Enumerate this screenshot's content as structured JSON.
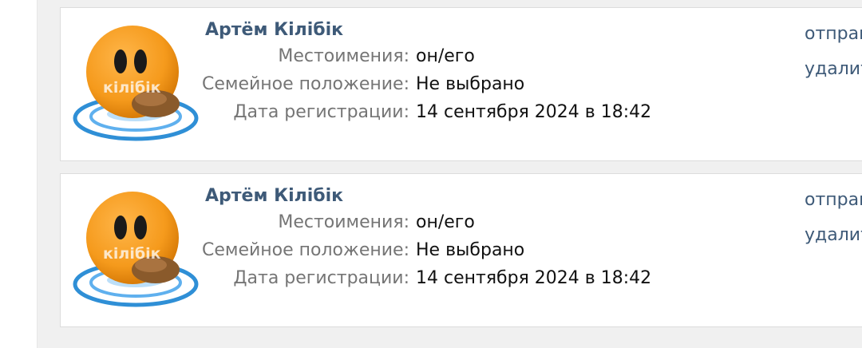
{
  "users": [
    {
      "name": "Артём Кілібік",
      "avatar_text": "кілібік",
      "fields": [
        {
          "label": "Местоимения:",
          "value": "он/его"
        },
        {
          "label": "Семейное положение:",
          "value": "Не выбрано"
        },
        {
          "label": "Дата регистрации:",
          "value": "14 сентября 2024 в 18:42"
        }
      ],
      "actions": [
        "отправ",
        "удалит"
      ]
    },
    {
      "name": "Артём Кілібік",
      "avatar_text": "кілібік",
      "fields": [
        {
          "label": "Местоимения:",
          "value": "он/его"
        },
        {
          "label": "Семейное положение:",
          "value": "Не выбрано"
        },
        {
          "label": "Дата регистрации:",
          "value": "14 сентября 2024 в 18:42"
        }
      ],
      "actions": [
        "отправ",
        "удалит"
      ]
    }
  ],
  "colors": {
    "link": "#3e5a78",
    "label": "#757575",
    "value": "#111111",
    "avatar_orange": "#f59a1c",
    "water_blue": "#2f8fd6"
  }
}
